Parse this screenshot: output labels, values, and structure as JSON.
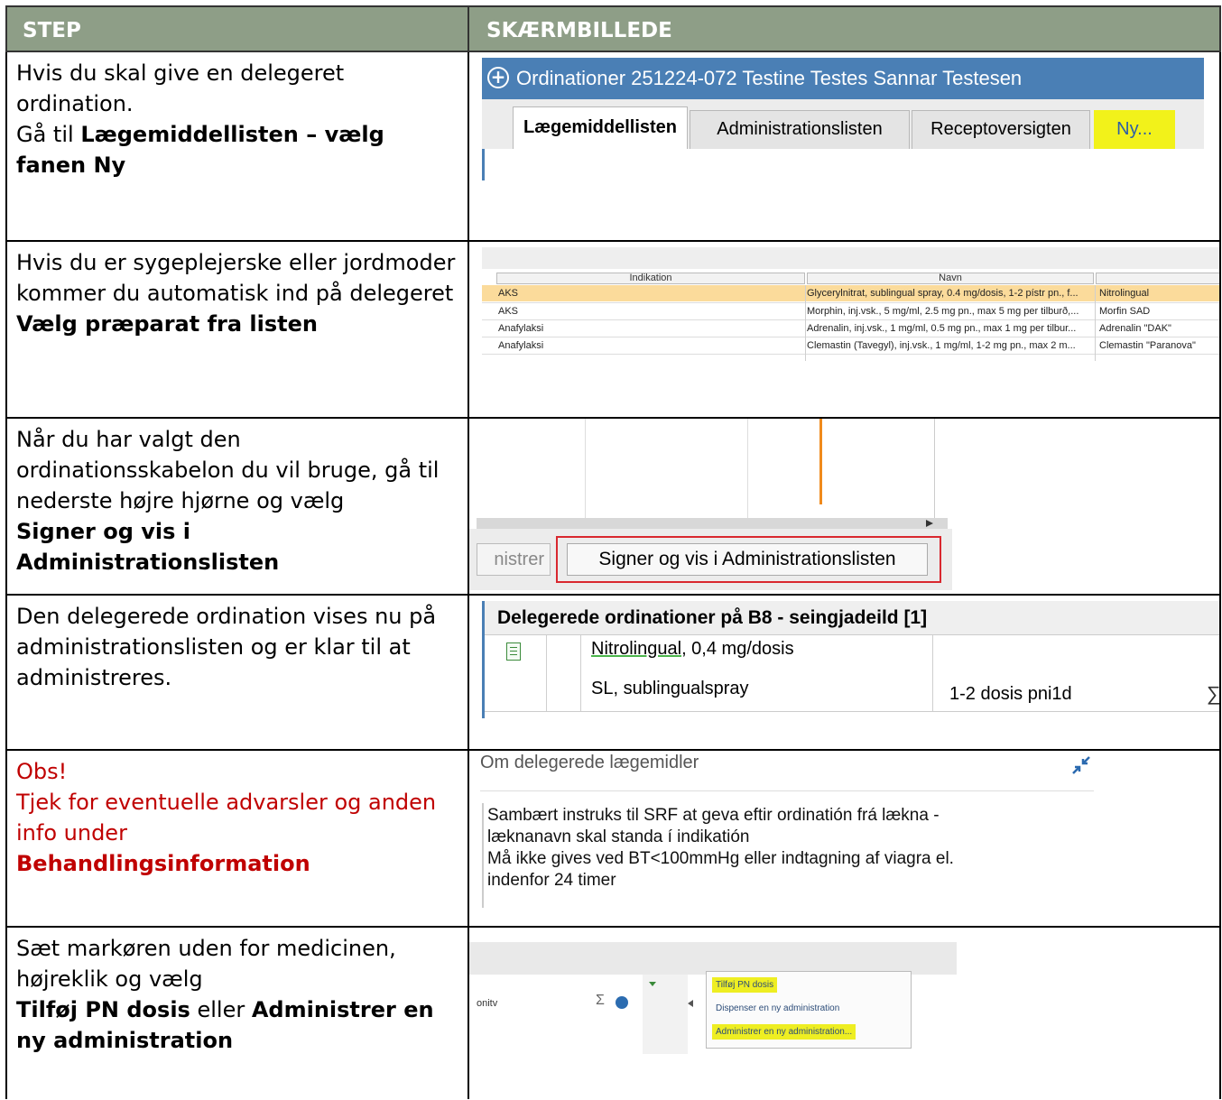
{
  "header": {
    "step": "STEP",
    "screen": "SKÆRMBILLEDE"
  },
  "rows": [
    {
      "step": {
        "p1": "Hvis du skal give en delegeret ordination.",
        "p2": "Gå til ",
        "p2b": "Lægemiddellisten – vælg fanen Ny"
      },
      "screen": {
        "title": "Ordinationer 251224-072 Testine Testes Sannar Testesen",
        "tabs": [
          "Lægemiddellisten",
          "Administrationslisten",
          "Receptoversigten",
          "Ny..."
        ]
      }
    },
    {
      "step": {
        "p1": "Hvis du er sygeplejerske eller jordmoder kommer du automatisk ind på delegeret",
        "p2b": "Vælg præparat fra listen"
      },
      "screen": {
        "columns": [
          "Indikation",
          "Navn"
        ],
        "rows": [
          [
            "AKS",
            "Glycerylnitrat, sublingual spray, 0.4 mg/dosis, 1-2 pístr pn., f...",
            "Nitrolingual"
          ],
          [
            "AKS",
            "Morphin, inj.vsk., 5 mg/ml, 2.5 mg pn., max 5 mg per tilburð,...",
            "Morfin SAD"
          ],
          [
            "Anafylaksi",
            "Adrenalin, inj.vsk., 1 mg/ml, 0.5 mg pn., max 1 mg per tilbur...",
            "Adrenalin \"DAK\""
          ],
          [
            "Anafylaksi",
            "Clemastin (Tavegyl), inj.vsk., 1 mg/ml, 1-2 mg pn., max 2 m...",
            "Clemastin \"Paranova\""
          ]
        ]
      }
    },
    {
      "step": {
        "p1": "Når du har valgt den ordinationsskabelon du vil bruge, gå til nederste højre hjørne og vælg",
        "p2b": "Signer og vis i Administrationslisten"
      },
      "screen": {
        "prev_button": "nistrer",
        "button": "Signer og vis i Administrationslisten"
      }
    },
    {
      "step": {
        "p1": "Den delegerede ordination vises nu på administrationslisten og er klar til at administreres."
      },
      "screen": {
        "heading": "Delegerede ordinationer på B8 - seingjadeild [1]",
        "drug_name": "Nitrolingual",
        "drug_strength": ", 0,4 mg/dosis",
        "route": "SL, sublingualspray",
        "dose": "1-2 dosis  pni1d",
        "sigma": "∑"
      }
    },
    {
      "step": {
        "obs": "Obs!",
        "p1": "Tjek for eventuelle advarsler og anden info under",
        "p2b": "Behandlingsinformation"
      },
      "screen": {
        "heading": "Om delegerede lægemidler",
        "lines": [
          "Sambært instruks til SRF at geva eftir ordinatión frá lækna -",
          "læknanavn skal standa í indikatión",
          "Må ikke gives ved BT<100mmHg eller indtagning af viagra el.",
          "indenfor 24 timer"
        ]
      }
    },
    {
      "step": {
        "p1": "Sæt markøren uden for medicinen, højreklik og vælg",
        "b1": "Tilføj PN dosis",
        "mid": " eller ",
        "b2": "Administrer en ny administration"
      },
      "screen": {
        "label": "onitv",
        "sigma": "Σ",
        "menu": [
          "Tilføj PN dosis",
          "Dispenser en ny administration",
          "Administrer en ny administration..."
        ]
      }
    }
  ],
  "colors": {
    "header_bg": "#8e9e87",
    "obs_red": "#c00000",
    "highlight": "#f2f21a",
    "accent_blue": "#4a7fb5"
  }
}
